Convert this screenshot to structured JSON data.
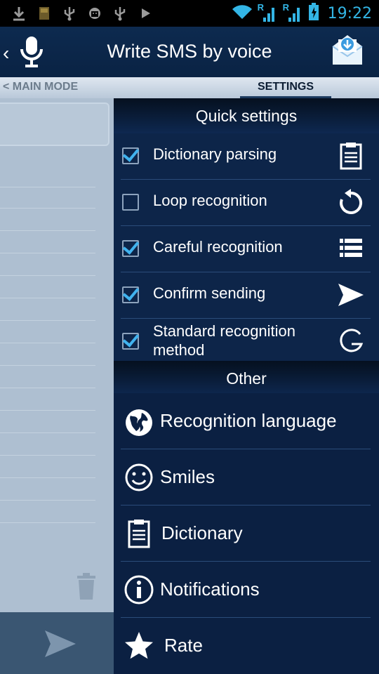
{
  "status_bar": {
    "time": "19:22",
    "icons": [
      "download-icon",
      "sd-card-icon",
      "usb-icon",
      "android-debug-icon",
      "usb-icon",
      "play-icon",
      "wifi-icon",
      "signal-roaming-icon",
      "signal-roaming-icon",
      "battery-charging-icon"
    ],
    "roaming_label": "R"
  },
  "action_bar": {
    "title": "Write SMS by voice",
    "back_icon": "back-chevron-icon",
    "app_icon": "microphone-icon",
    "action_icon": "mail-download-icon"
  },
  "tabs": {
    "main_label": "< MAIN MODE",
    "settings_label": "SETTINGS"
  },
  "drawer": {
    "quick_header": "Quick settings",
    "quick_settings": [
      {
        "label": "Dictionary parsing",
        "checked": true,
        "icon": "clipboard-icon"
      },
      {
        "label": "Loop recognition",
        "checked": false,
        "icon": "refresh-icon"
      },
      {
        "label": "Careful recognition",
        "checked": true,
        "icon": "list-icon"
      },
      {
        "label": "Confirm sending",
        "checked": true,
        "icon": "send-icon"
      },
      {
        "label": "Standard recognition method",
        "checked": true,
        "icon": "google-g-icon"
      }
    ],
    "other_header": "Other",
    "other": [
      {
        "label": "Recognition language",
        "icon": "globe-icon"
      },
      {
        "label": "Smiles",
        "icon": "smiley-icon"
      },
      {
        "label": "Dictionary",
        "icon": "clipboard-icon"
      },
      {
        "label": "Notifications",
        "icon": "info-icon"
      },
      {
        "label": "Rate",
        "icon": "star-icon"
      }
    ]
  },
  "colors": {
    "accent": "#41b3ef",
    "drawer_bg": "#0b2042",
    "action_bar_bg": "#0d2a4f"
  }
}
